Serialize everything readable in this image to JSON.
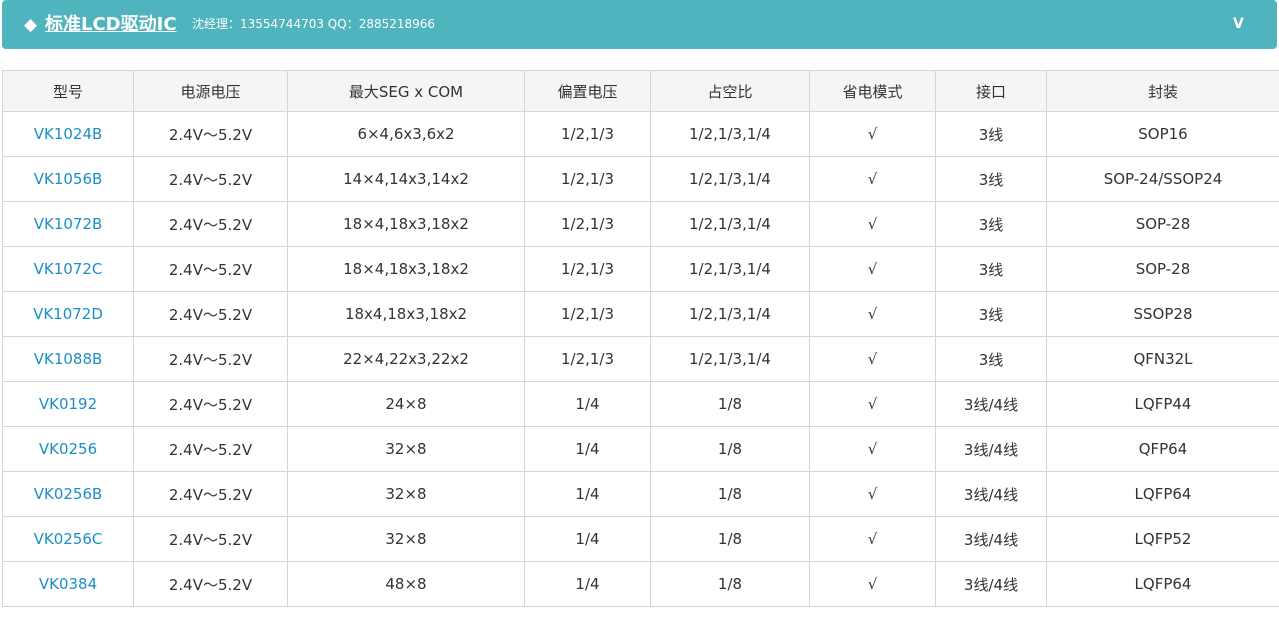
{
  "header": {
    "diamond": "◆",
    "title": "标准LCD驱动IC",
    "contact": "沈经理：13554744703   QQ：2885218966",
    "expand_icon": "V"
  },
  "colors": {
    "header_bg": "#4fb4bd",
    "model_link": "#1b8fc4",
    "table_header_bg": "#f5f5f5",
    "border": "#d5d5d5"
  },
  "table": {
    "columns": [
      "型号",
      "电源电压",
      "最大SEG x COM",
      "偏置电压",
      "占空比",
      "省电模式",
      "接口",
      "封装"
    ],
    "rows": [
      [
        "VK1024B",
        "2.4V～5.2V",
        "6×4,6x3,6x2",
        "1/2,1/3",
        "1/2,1/3,1/4",
        "√",
        "3线",
        "SOP16"
      ],
      [
        "VK1056B",
        "2.4V～5.2V",
        "14×4,14x3,14x2",
        "1/2,1/3",
        "1/2,1/3,1/4",
        "√",
        "3线",
        "SOP-24/SSOP24"
      ],
      [
        "VK1072B",
        "2.4V～5.2V",
        "18×4,18x3,18x2",
        "1/2,1/3",
        "1/2,1/3,1/4",
        "√",
        "3线",
        "SOP-28"
      ],
      [
        "VK1072C",
        "2.4V～5.2V",
        "18×4,18x3,18x2",
        "1/2,1/3",
        "1/2,1/3,1/4",
        "√",
        "3线",
        "SOP-28"
      ],
      [
        "VK1072D",
        "2.4V～5.2V",
        "18x4,18x3,18x2",
        "1/2,1/3",
        "1/2,1/3,1/4",
        "√",
        "3线",
        "SSOP28"
      ],
      [
        "VK1088B",
        "2.4V～5.2V",
        "22×4,22x3,22x2",
        "1/2,1/3",
        "1/2,1/3,1/4",
        "√",
        "3线",
        "QFN32L"
      ],
      [
        "VK0192",
        "2.4V～5.2V",
        "24×8",
        "1/4",
        "1/8",
        "√",
        "3线/4线",
        "LQFP44"
      ],
      [
        "VK0256",
        "2.4V～5.2V",
        "32×8",
        "1/4",
        "1/8",
        "√",
        "3线/4线",
        "QFP64"
      ],
      [
        "VK0256B",
        "2.4V～5.2V",
        "32×8",
        "1/4",
        "1/8",
        "√",
        "3线/4线",
        "LQFP64"
      ],
      [
        "VK0256C",
        "2.4V～5.2V",
        "32×8",
        "1/4",
        "1/8",
        "√",
        "3线/4线",
        "LQFP52"
      ],
      [
        "VK0384",
        "2.4V～5.2V",
        "48×8",
        "1/4",
        "1/8",
        "√",
        "3线/4线",
        "LQFP64"
      ]
    ]
  }
}
